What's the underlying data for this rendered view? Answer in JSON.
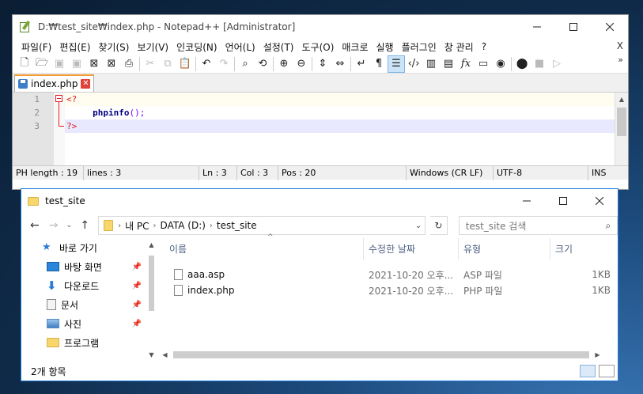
{
  "npp": {
    "title": "D:₩test_site₩index.php - Notepad++ [Administrator]",
    "menu": [
      "파일(F)",
      "편집(E)",
      "찾기(S)",
      "보기(V)",
      "인코딩(N)",
      "언어(L)",
      "설정(T)",
      "도구(O)",
      "매크로",
      "실행",
      "플러그인",
      "창 관리",
      "?"
    ],
    "menu_close": "X",
    "toolbar_more": "»",
    "tab": {
      "label": "index.php",
      "close": "✕"
    },
    "lines": [
      {
        "num": "1",
        "tokens": [
          {
            "t": "<?",
            "c": "tok-php"
          }
        ]
      },
      {
        "num": "2",
        "tokens": [
          {
            "t": "     ",
            "c": ""
          },
          {
            "t": "phpinfo",
            "c": "tok-fn"
          },
          {
            "t": "();",
            "c": "tok-p"
          }
        ]
      },
      {
        "num": "3",
        "tokens": [
          {
            "t": "?>",
            "c": "tok-php"
          }
        ]
      }
    ],
    "status": {
      "length": "PH length : 19",
      "lines": "lines : 3",
      "ln": "Ln : 3",
      "col": "Col : 3",
      "pos": "Pos : 20",
      "eol": "Windows (CR LF)",
      "encoding": "UTF-8",
      "mode": "INS"
    }
  },
  "explorer": {
    "title": "test_site",
    "breadcrumb": [
      "내 PC",
      "DATA (D:)",
      "test_site"
    ],
    "search_placeholder": "test_site 검색",
    "nav": [
      {
        "label": "바로 가기",
        "icon": "star-icon",
        "pinned": false
      },
      {
        "label": "바탕 화면",
        "icon": "desktop-icon",
        "pinned": true
      },
      {
        "label": "다운로드",
        "icon": "download-icon",
        "pinned": true
      },
      {
        "label": "문서",
        "icon": "document-icon",
        "pinned": true
      },
      {
        "label": "사진",
        "icon": "picture-icon",
        "pinned": true
      },
      {
        "label": "프로그램",
        "icon": "folder-icon",
        "pinned": false
      }
    ],
    "columns": [
      "이름",
      "수정한 날짜",
      "유형",
      "크기"
    ],
    "files": [
      {
        "name": "aaa.asp",
        "date": "2021-10-20 오후...",
        "type": "ASP 파일",
        "size": "1KB"
      },
      {
        "name": "index.php",
        "date": "2021-10-20 오후...",
        "type": "PHP 파일",
        "size": "1KB"
      }
    ],
    "status": "2개 항목"
  }
}
